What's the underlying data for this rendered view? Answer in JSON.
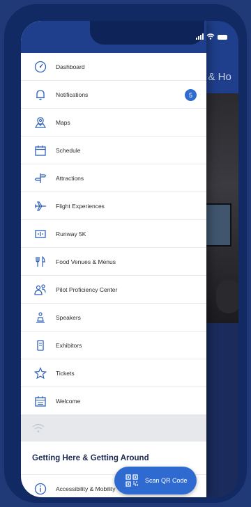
{
  "background": {
    "title_fragment": "g & Ho"
  },
  "menu": {
    "items": [
      {
        "label": "Dashboard",
        "icon": "dashboard-icon"
      },
      {
        "label": "Notifications",
        "icon": "bell-icon",
        "badge": "5"
      },
      {
        "label": "Maps",
        "icon": "map-icon"
      },
      {
        "label": "Schedule",
        "icon": "calendar-icon"
      },
      {
        "label": "Attractions",
        "icon": "signpost-icon"
      },
      {
        "label": "Flight Experiences",
        "icon": "airplane-icon"
      },
      {
        "label": "Runway 5K",
        "icon": "runway-icon"
      },
      {
        "label": "Food Venues & Menus",
        "icon": "utensils-icon"
      },
      {
        "label": "Pilot Proficiency Center",
        "icon": "people-icon"
      },
      {
        "label": "Speakers",
        "icon": "speaker-icon"
      },
      {
        "label": "Exhibitors",
        "icon": "exhibitor-icon"
      },
      {
        "label": "Tickets",
        "icon": "star-icon"
      },
      {
        "label": "Welcome",
        "icon": "calendar-icon"
      }
    ],
    "section_title": "Getting Here & Getting Around",
    "section_items": [
      {
        "label": "Accessibility & Mobility",
        "icon": "info-icon"
      }
    ]
  },
  "qr_button": {
    "label": "Scan QR Code"
  },
  "colors": {
    "accent": "#2f6ad1",
    "header": "#1f3f8c",
    "frame": "#203a78"
  }
}
